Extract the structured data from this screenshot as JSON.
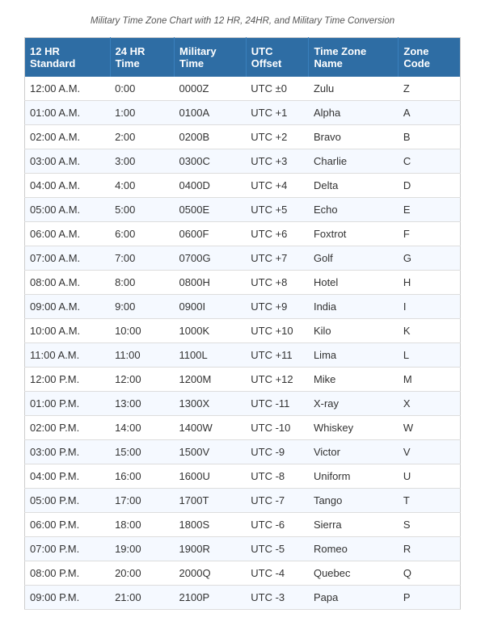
{
  "subtitle": "Military Time Zone Chart with 12 HR, 24HR, and Military Time Conversion",
  "table": {
    "headers": [
      "12 HR Standard",
      "24 HR Time",
      "Military Time",
      "UTC Offset",
      "Time Zone Name",
      "Zone Code"
    ],
    "rows": [
      [
        "12:00 A.M.",
        "0:00",
        "0000Z",
        "UTC ±0",
        "Zulu",
        "Z"
      ],
      [
        "01:00 A.M.",
        "1:00",
        "0100A",
        "UTC +1",
        "Alpha",
        "A"
      ],
      [
        "02:00 A.M.",
        "2:00",
        "0200B",
        "UTC +2",
        "Bravo",
        "B"
      ],
      [
        "03:00 A.M.",
        "3:00",
        "0300C",
        "UTC +3",
        "Charlie",
        "C"
      ],
      [
        "04:00 A.M.",
        "4:00",
        "0400D",
        "UTC +4",
        "Delta",
        "D"
      ],
      [
        "05:00 A.M.",
        "5:00",
        "0500E",
        "UTC +5",
        "Echo",
        "E"
      ],
      [
        "06:00 A.M.",
        "6:00",
        "0600F",
        "UTC +6",
        "Foxtrot",
        "F"
      ],
      [
        "07:00 A.M.",
        "7:00",
        "0700G",
        "UTC +7",
        "Golf",
        "G"
      ],
      [
        "08:00 A.M.",
        "8:00",
        "0800H",
        "UTC +8",
        "Hotel",
        "H"
      ],
      [
        "09:00 A.M.",
        "9:00",
        "0900I",
        "UTC +9",
        "India",
        "I"
      ],
      [
        "10:00 A.M.",
        "10:00",
        "1000K",
        "UTC +10",
        "Kilo",
        "K"
      ],
      [
        "11:00 A.M.",
        "11:00",
        "1100L",
        "UTC +11",
        "Lima",
        "L"
      ],
      [
        "12:00 P.M.",
        "12:00",
        "1200M",
        "UTC +12",
        "Mike",
        "M"
      ],
      [
        "01:00 P.M.",
        "13:00",
        "1300X",
        "UTC -11",
        "X-ray",
        "X"
      ],
      [
        "02:00 P.M.",
        "14:00",
        "1400W",
        "UTC -10",
        "Whiskey",
        "W"
      ],
      [
        "03:00 P.M.",
        "15:00",
        "1500V",
        "UTC -9",
        "Victor",
        "V"
      ],
      [
        "04:00 P.M.",
        "16:00",
        "1600U",
        "UTC -8",
        "Uniform",
        "U"
      ],
      [
        "05:00 P.M.",
        "17:00",
        "1700T",
        "UTC -7",
        "Tango",
        "T"
      ],
      [
        "06:00 P.M.",
        "18:00",
        "1800S",
        "UTC -6",
        "Sierra",
        "S"
      ],
      [
        "07:00 P.M.",
        "19:00",
        "1900R",
        "UTC -5",
        "Romeo",
        "R"
      ],
      [
        "08:00 P.M.",
        "20:00",
        "2000Q",
        "UTC -4",
        "Quebec",
        "Q"
      ],
      [
        "09:00 P.M.",
        "21:00",
        "2100P",
        "UTC -3",
        "Papa",
        "P"
      ]
    ]
  }
}
